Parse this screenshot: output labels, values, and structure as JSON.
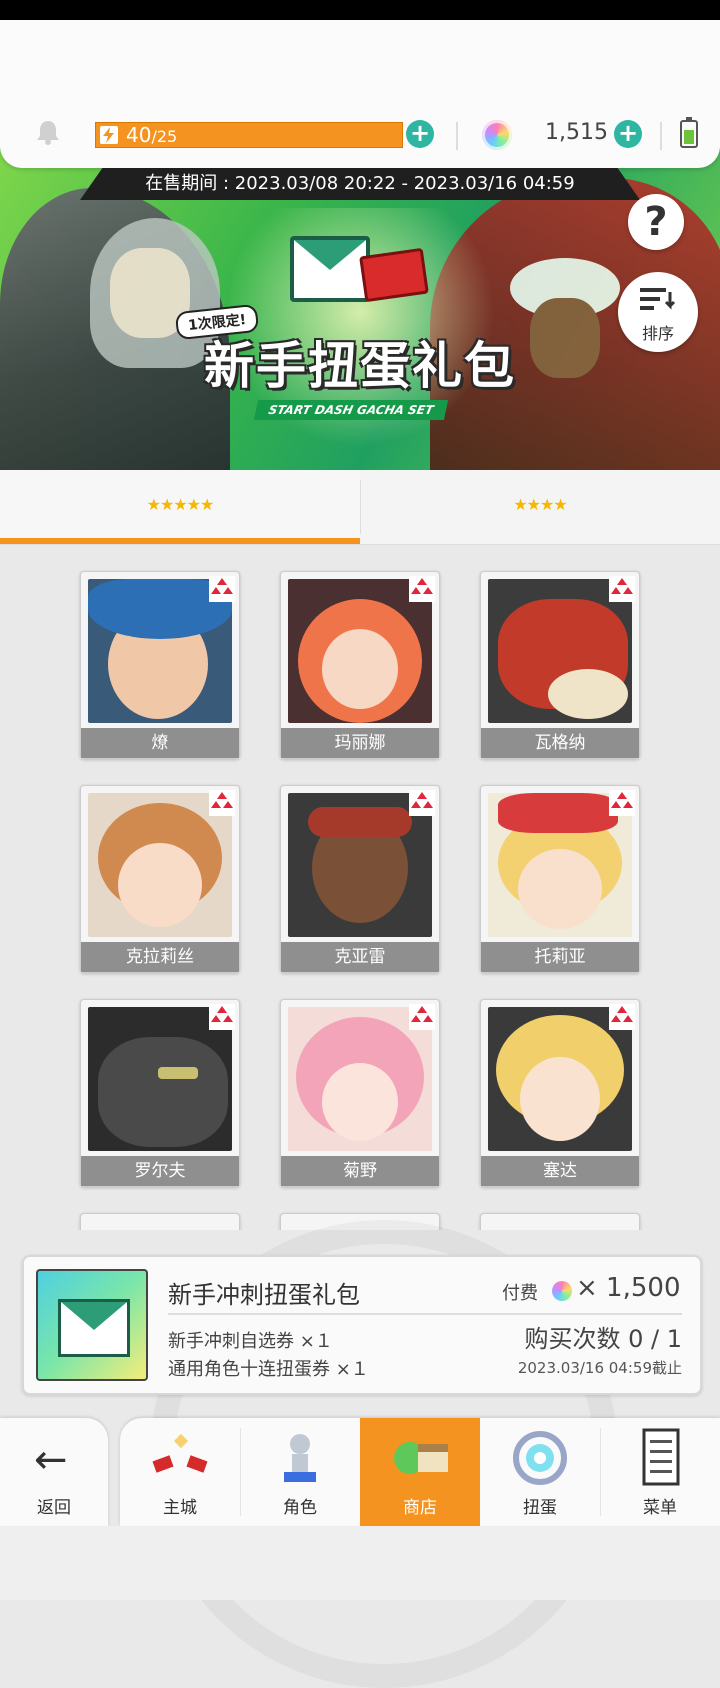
{
  "header": {
    "stamina_current": "40",
    "stamina_max": "/25",
    "gem_count": "1,515"
  },
  "banner": {
    "sale_period": "在售期间 : 2023.03/08 20:22 - 2023.03/16 04:59",
    "limited_label": "1次限定!",
    "title": "新手扭蛋礼包",
    "subtitle": "START DASH GACHA SET",
    "help_label": "?",
    "sort_label": "排序"
  },
  "tabs": [
    {
      "label": "★★★★★",
      "active": true
    },
    {
      "label": "★★★★",
      "active": false
    }
  ],
  "characters": [
    {
      "name": "燎",
      "stars": "★★★★★",
      "element": "fire"
    },
    {
      "name": "玛丽娜",
      "stars": "★★★★★",
      "element": "fire"
    },
    {
      "name": "瓦格纳",
      "stars": "★★★★★",
      "element": "fire"
    },
    {
      "name": "克拉莉丝",
      "stars": "★★★★★",
      "element": "fire"
    },
    {
      "name": "克亚雷",
      "stars": "★★★★★",
      "element": "fire"
    },
    {
      "name": "托莉亚",
      "stars": "★★★★★",
      "element": "fire"
    },
    {
      "name": "罗尔夫",
      "stars": "★★★★★",
      "element": "fire"
    },
    {
      "name": "菊野",
      "stars": "★★★★★",
      "element": "fire"
    },
    {
      "name": "塞达",
      "stars": "★★★★★",
      "element": "fire"
    }
  ],
  "pack": {
    "name": "新手冲刺扭蛋礼包",
    "item1": "新手冲刺自选券 ×１",
    "item2": "通用角色十连扭蛋券 ×１",
    "price_label": "付费",
    "price_value": "× 1,500",
    "buy_count": "购买次数 0 / 1",
    "deadline": "2023.03/16 04:59截止"
  },
  "nav": {
    "back": "返回",
    "items": [
      {
        "label": "主城",
        "icon": "castle-icon"
      },
      {
        "label": "角色",
        "icon": "character-icon"
      },
      {
        "label": "商店",
        "icon": "shop-icon",
        "active": true
      },
      {
        "label": "扭蛋",
        "icon": "gacha-icon"
      },
      {
        "label": "菜单",
        "icon": "menu-icon"
      }
    ]
  },
  "colors": {
    "accent_orange": "#f4931f",
    "teal_plus": "#2fb6a3",
    "fire_element": "#e0263a"
  }
}
